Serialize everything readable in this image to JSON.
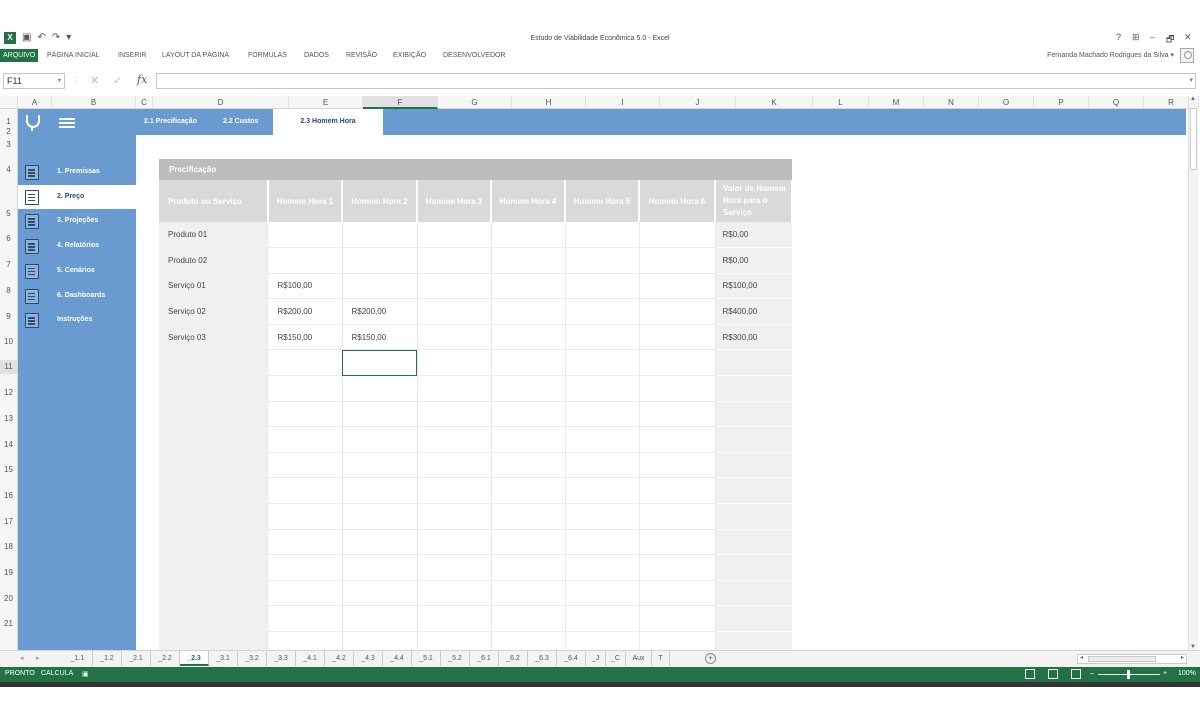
{
  "window": {
    "title": "Estudo de Viabilidade Econômica 5.0 - Excel",
    "help": "?",
    "controls": [
      "⊞",
      "–",
      "🗗",
      "✕"
    ]
  },
  "ribbon": {
    "tabs": [
      "ARQUIVO",
      "PÁGINA INICIAL",
      "INSERIR",
      "LAYOUT DA PÁGINA",
      "FÓRMULAS",
      "DADOS",
      "REVISÃO",
      "EXIBIÇÃO",
      "DESENVOLVEDOR"
    ],
    "user": "Fernanda Machado Rodrigues da Silva ▾"
  },
  "formula_bar": {
    "name_box": "F11",
    "fx": "fx",
    "value": ""
  },
  "columns": [
    "A",
    "B",
    "C",
    "D",
    "E",
    "F",
    "G",
    "H",
    "I",
    "J",
    "K",
    "L",
    "M",
    "N",
    "O",
    "P",
    "Q",
    "R"
  ],
  "active_column": "F",
  "rows": [
    "1",
    "2",
    "3",
    "4",
    "5",
    "6",
    "7",
    "8",
    "9",
    "10",
    "11",
    "12",
    "13",
    "14",
    "15",
    "16",
    "17",
    "18",
    "19",
    "20",
    "21"
  ],
  "active_row": "11",
  "subtabs": [
    "2.1 Precificação",
    "2.2 Custos",
    "2.3 Homem Hora"
  ],
  "active_subtab": 2,
  "sidebar": {
    "items": [
      {
        "label": "1. Premissas",
        "icon": "premissas-icon"
      },
      {
        "label": "2. Preço",
        "icon": "preco-icon"
      },
      {
        "label": "3. Projeções",
        "icon": "projecoes-icon"
      },
      {
        "label": "4. Relatórios",
        "icon": "relatorios-icon"
      },
      {
        "label": "5. Cenários",
        "icon": "cenarios-icon"
      },
      {
        "label": "6. Dashboards",
        "icon": "dashboards-icon"
      },
      {
        "label": "Instruções",
        "icon": "instrucoes-icon"
      }
    ],
    "active": 1
  },
  "table": {
    "title": "Precificação",
    "headers": [
      "Produto ou Serviço",
      "Homem Hora 1",
      "Homem Hora 2",
      "Homem Hora 3",
      "Homem Hora 4",
      "Homem Hora 5",
      "Homem Hora 6",
      "Valor de Homem Hora para o Serviço"
    ],
    "rows": [
      [
        "Produto 01",
        "",
        "",
        "",
        "",
        "",
        "",
        "R$0,00"
      ],
      [
        "Produto 02",
        "",
        "",
        "",
        "",
        "",
        "",
        "R$0,00"
      ],
      [
        "Serviço 01",
        "R$100,00",
        "",
        "",
        "",
        "",
        "",
        "R$100,00"
      ],
      [
        "Serviço 02",
        "R$200,00",
        "R$200,00",
        "",
        "",
        "",
        "",
        "R$400,00"
      ],
      [
        "Serviço 03",
        "R$150,00",
        "R$150,00",
        "",
        "",
        "",
        "",
        "R$300,00"
      ],
      [
        "",
        "",
        "",
        "",
        "",
        "",
        "",
        ""
      ],
      [
        "",
        "",
        "",
        "",
        "",
        "",
        "",
        ""
      ],
      [
        "",
        "",
        "",
        "",
        "",
        "",
        "",
        ""
      ],
      [
        "",
        "",
        "",
        "",
        "",
        "",
        "",
        ""
      ],
      [
        "",
        "",
        "",
        "",
        "",
        "",
        "",
        ""
      ],
      [
        "",
        "",
        "",
        "",
        "",
        "",
        "",
        ""
      ],
      [
        "",
        "",
        "",
        "",
        "",
        "",
        "",
        ""
      ],
      [
        "",
        "",
        "",
        "",
        "",
        "",
        "",
        ""
      ],
      [
        "",
        "",
        "",
        "",
        "",
        "",
        "",
        ""
      ],
      [
        "",
        "",
        "",
        "",
        "",
        "",
        "",
        ""
      ],
      [
        "",
        "",
        "",
        "",
        "",
        "",
        "",
        ""
      ],
      [
        "",
        "",
        "",
        "",
        "",
        "",
        "",
        ""
      ]
    ],
    "selected_cell": [
      5,
      2
    ]
  },
  "sheet_tabs": [
    "_1.1",
    "_1.2",
    "_2.1",
    "_2.2",
    "_2.3",
    "_3.1",
    "_3.2",
    "_3.3",
    "_4.1",
    "_4.2",
    "_4.3",
    "_4.4",
    "_5.1",
    "_5.2",
    "_6.1",
    "_6.2",
    "_6.3",
    "_6.4",
    "_J",
    "_C",
    "Aux",
    "T"
  ],
  "active_sheet": 4,
  "status": {
    "ready": "PRONTO",
    "calc": "CALCULA",
    "zoom": "100%"
  },
  "colors": {
    "excel_green": "#217346",
    "panel_blue": "#6a9bd0",
    "header_gray": "#d9d9d9"
  }
}
